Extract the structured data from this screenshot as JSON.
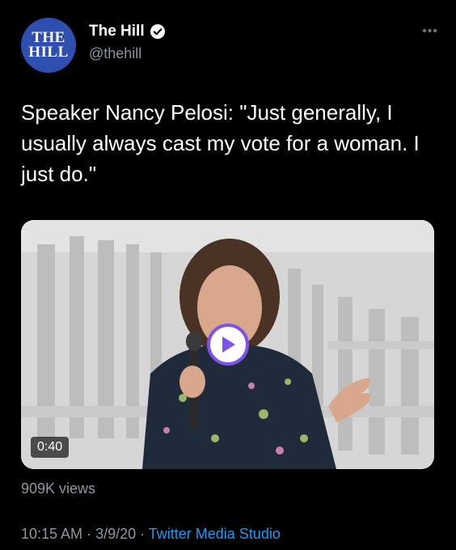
{
  "author": {
    "avatar_text_top": "THE",
    "avatar_text_bottom": "HILL",
    "display_name": "The Hill",
    "handle": "@thehill",
    "verified": true,
    "more_label": "•••"
  },
  "tweet": {
    "text": "Speaker Nancy Pelosi: \"Just generally, I usually always cast my vote for a woman. I just do.\""
  },
  "media": {
    "type": "video",
    "duration": "0:40",
    "play_icon": "play-icon",
    "accent_color": "#7d52e8"
  },
  "stats": {
    "views": "909K views"
  },
  "meta": {
    "time": "10:15 AM",
    "separator": " · ",
    "date": "3/9/20",
    "source": "Twitter Media Studio"
  },
  "colors": {
    "background": "#000000",
    "link": "#1d9bf0",
    "secondary_text": "#8b98a5",
    "avatar_bg": "#2f4fb0"
  }
}
